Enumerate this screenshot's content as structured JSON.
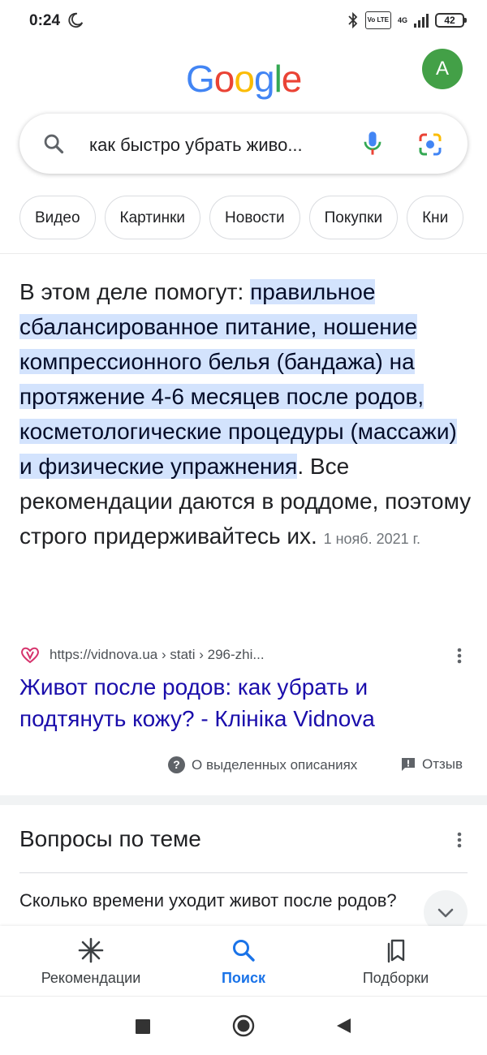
{
  "status_bar": {
    "time": "0:24",
    "network": "4G",
    "volte": "Vo LTE",
    "battery": "42"
  },
  "header": {
    "logo": "Google",
    "logo_colors": [
      "#4285F4",
      "#EA4335",
      "#FBBC05",
      "#4285F4",
      "#34A853",
      "#EA4335"
    ],
    "avatar_letter": "A",
    "avatar_color": "#43a047"
  },
  "search": {
    "query": "как быстро убрать живо..."
  },
  "chips": [
    "Видео",
    "Картинки",
    "Новости",
    "Покупки",
    "Кни"
  ],
  "snippet": {
    "lead": "В этом деле помогут: ",
    "highlighted": "правильное сбалансированное питание, ношение компрессионного белья (бандажа) на протяжение 4-6 месяцев после родов, косметологические процедуры (массажи) и физические упражнения",
    "rest": ". Все рекомендации даются в роддоме, поэтому строго придерживайтесь их.",
    "date": "1 нояб. 2021 г."
  },
  "result": {
    "url": "https://vidnova.ua › stati › 296-zhi...",
    "title": "Живот после родов: как убрать и подтянуть кожу? - Клiнiка Vidnova"
  },
  "feedback": {
    "about": "О выделенных описаниях",
    "report": "Отзыв"
  },
  "paa": {
    "title": "Вопросы по теме",
    "question": "Сколько времени уходит живот после родов?"
  },
  "bottom_nav": [
    {
      "label": "Рекомендации",
      "icon": "asterisk-icon",
      "active": false
    },
    {
      "label": "Поиск",
      "icon": "search-icon",
      "active": true
    },
    {
      "label": "Подборки",
      "icon": "collections-icon",
      "active": false
    }
  ],
  "colors": {
    "highlight": "#d3e3fd",
    "link": "#1a0dab",
    "active": "#1a73e8"
  }
}
